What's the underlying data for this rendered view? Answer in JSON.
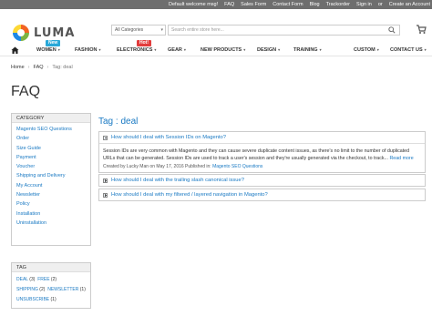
{
  "topbar": {
    "links": [
      "Default welcome msg!",
      "FAQ",
      "Sales Form",
      "Contact Form",
      "Blog",
      "Trackorder",
      "Sign in",
      "or",
      "Create an Account"
    ]
  },
  "header": {
    "logo_text": "LUMA",
    "category_select": "All Categories",
    "search_placeholder": "Search entire store here..."
  },
  "nav": {
    "items": [
      {
        "label": "WOMEN",
        "dropdown": true,
        "badge": "New"
      },
      {
        "label": "FASHION",
        "dropdown": true
      },
      {
        "label": "ELECTRONICS",
        "dropdown": true,
        "badge": "Hot!"
      },
      {
        "label": "GEAR",
        "dropdown": true
      },
      {
        "label": "NEW PRODUCTS",
        "dropdown": true
      },
      {
        "label": "DESIGN",
        "dropdown": true
      },
      {
        "label": "TRAINING",
        "dropdown": true
      },
      {
        "label": "CUSTOM",
        "dropdown": true
      },
      {
        "label": "CONTACT US",
        "dropdown": true
      }
    ]
  },
  "breadcrumb": {
    "home": "Home",
    "faq": "FAQ",
    "current": "Tag: deal"
  },
  "page_title": "FAQ",
  "sidebar": {
    "category_title": "CATEGORY",
    "categories": [
      "Magento SEO Questions",
      "Order",
      "Size Guide",
      "Payment",
      "Voucher",
      "Shipping and Delivery",
      "My Account",
      "Newsletter",
      "Policy",
      "Installation",
      "Uninstallation"
    ],
    "tag_title": "TAG",
    "tags": [
      {
        "name": "DEAL",
        "count": "(3)"
      },
      {
        "name": "FREE",
        "count": "(2)"
      },
      {
        "name": "SHIPPING",
        "count": "(2)"
      },
      {
        "name": "NEWSLETTER",
        "count": "(1)"
      },
      {
        "name": "UNSUBSCRIBE",
        "count": "(1)"
      }
    ]
  },
  "main": {
    "tag_heading": "Tag : deal",
    "faqs": [
      {
        "question": "How should I deal with Session IDs on Magento?",
        "expanded": true,
        "answer": "Session IDs are very common with Magento and they can cause severe duplicate content issues, as there's no limit to the number of duplicated URLs that can be generated. Session IDs are used to track a user's session and they're usually generated via the checkout, to track...",
        "read_more": "Read more",
        "meta_prefix": "Created by Lucky Man on May 17, 2016 Published in:",
        "meta_category": "Magento SEO Questions"
      },
      {
        "question": "How should I deal with the trailing slash canonical issue?",
        "expanded": false
      },
      {
        "question": "How should I deal with my filtered / layered navigation in Magento?",
        "expanded": false
      }
    ]
  },
  "colors": {
    "link": "#1979c3",
    "topbar": "#6e6e6e",
    "badge_new": "#29a8d8",
    "badge_hot": "#e23c3c"
  }
}
